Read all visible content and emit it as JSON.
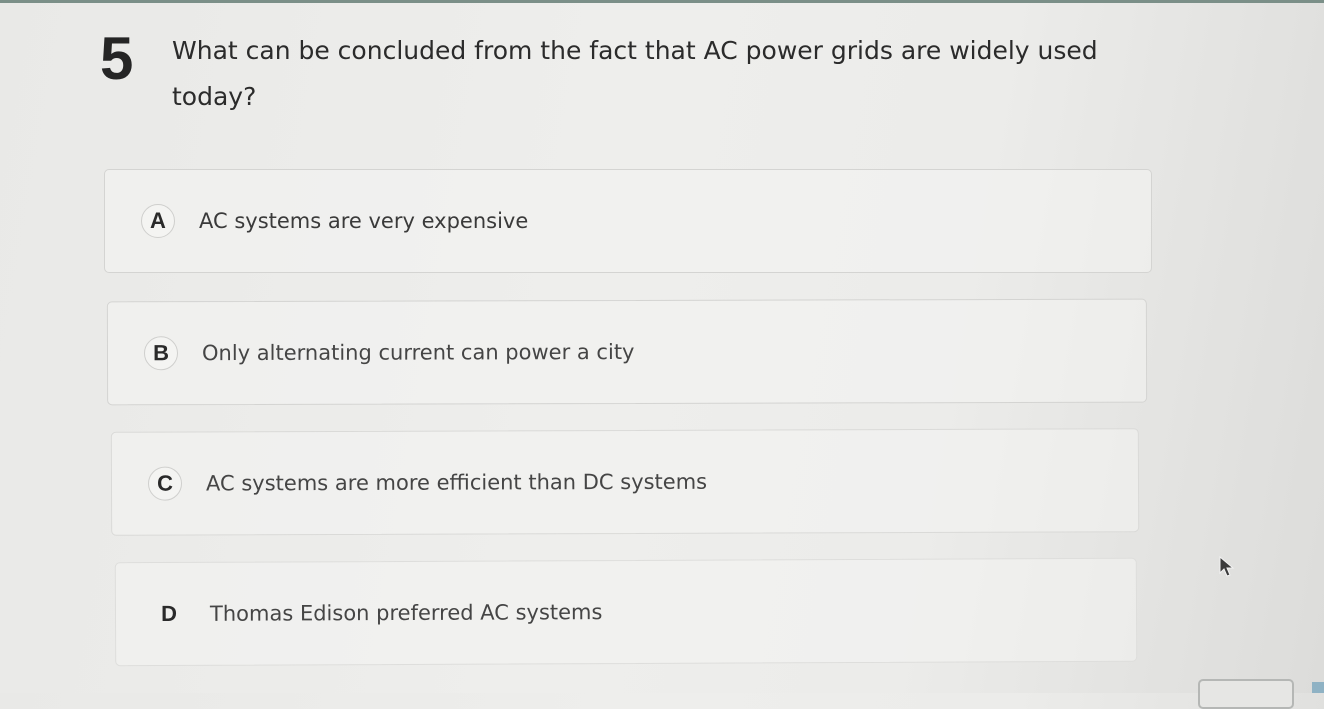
{
  "question": {
    "number": "5",
    "text": "What can be concluded from the fact that AC power grids are widely used today?"
  },
  "options": [
    {
      "letter": "A",
      "text": "AC systems are very expensive"
    },
    {
      "letter": "B",
      "text": "Only alternating current can power a city"
    },
    {
      "letter": "C",
      "text": "AC systems are more efficient than DC systems"
    },
    {
      "letter": "D",
      "text": "Thomas Edison preferred AC systems"
    }
  ],
  "icons": {
    "cursor": "mouse-pointer-icon"
  },
  "colors": {
    "background": "#ececea",
    "text": "#2b2b2b",
    "option_border": "#d4d4d2",
    "corner_accent": "#8fb2c4"
  }
}
